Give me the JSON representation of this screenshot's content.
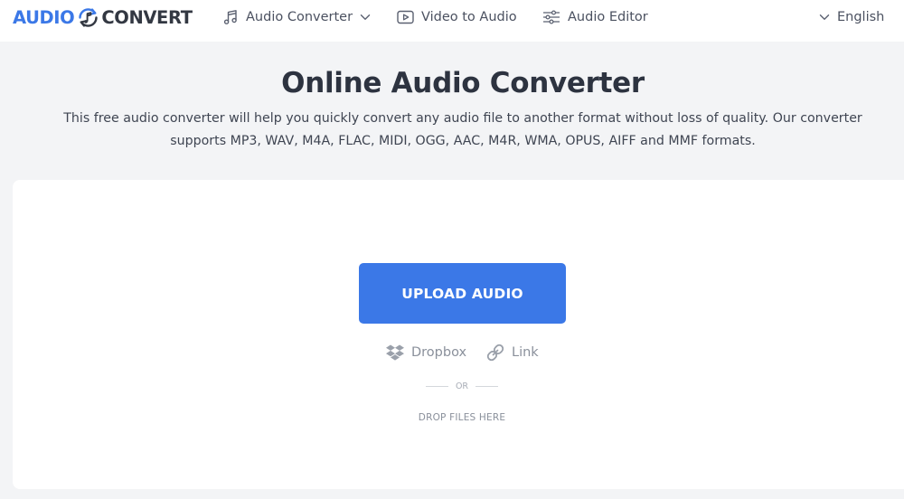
{
  "logo": {
    "part1": "AUDIO",
    "part2": "CONVERT",
    "icon": "music-note-refresh-icon"
  },
  "nav": {
    "audio_converter": {
      "label": "Audio Converter",
      "icon": "music-note-icon"
    },
    "video_to_audio": {
      "label": "Video to Audio",
      "icon": "play-icon"
    },
    "audio_editor": {
      "label": "Audio Editor",
      "icon": "sliders-icon"
    },
    "language": {
      "label": "English",
      "icon": "chevron-down-icon"
    }
  },
  "hero": {
    "title": "Online Audio Converter",
    "subtitle_line1": "This free audio converter will help you quickly convert any audio file to another format without loss of quality. Our converter",
    "subtitle_line2": "supports MP3, WAV, M4A, FLAC, MIDI, OGG, AAC, M4R, WMA, OPUS, AIFF and MMF formats."
  },
  "upload": {
    "button_label": "UPLOAD AUDIO",
    "dropbox_label": "Dropbox",
    "link_label": "Link",
    "or_label": "OR",
    "drop_label": "DROP FILES HERE"
  },
  "colors": {
    "accent": "#3b78e7",
    "page_background": "#f3f4f6",
    "text_dark": "#2d3340",
    "text_muted": "#8a909b"
  }
}
